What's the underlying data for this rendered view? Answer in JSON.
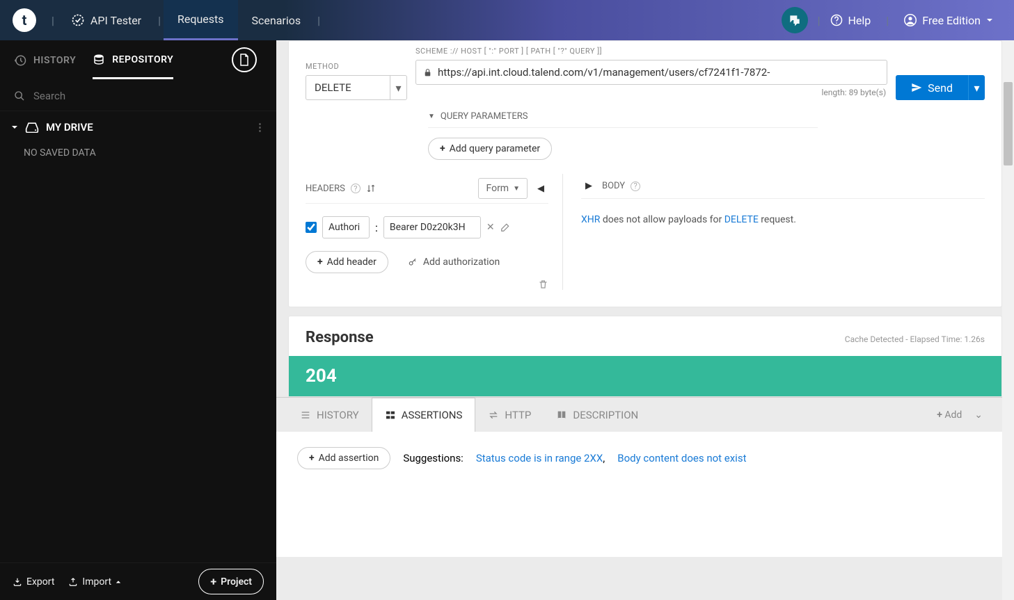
{
  "nav": {
    "brand": "t",
    "api_tester": "API Tester",
    "requests": "Requests",
    "scenarios": "Scenarios",
    "help": "Help",
    "edition": "Free Edition"
  },
  "sidebar": {
    "history": "HISTORY",
    "repository": "REPOSITORY",
    "search_placeholder": "Search",
    "my_drive": "MY DRIVE",
    "no_data": "NO SAVED DATA",
    "export": "Export",
    "import": "Import",
    "project": "Project"
  },
  "request": {
    "method_label": "METHOD",
    "method": "DELETE",
    "url_label": "SCHEME :// HOST [ \":\" PORT ] [ PATH [ \"?\" QUERY ]]",
    "url": "https://api.int.cloud.talend.com/v1/management/users/cf7241f1-7872-",
    "length": "length: 89 byte(s)",
    "send": "Send",
    "qp_title": "QUERY PARAMETERS",
    "qp_add": "Add query parameter",
    "headers_label": "HEADERS",
    "form": "Form",
    "hdr_name": "Authori",
    "hdr_val": "Bearer D0z20k3H",
    "add_header": "Add header",
    "add_auth": "Add authorization",
    "body_label": "BODY",
    "body_xhr": "XHR",
    "body_mid": " does not allow payloads for ",
    "body_delete": "DELETE",
    "body_end": " request."
  },
  "response": {
    "title": "Response",
    "meta": "Cache Detected - Elapsed Time: 1.26s",
    "status": "204"
  },
  "tabs": {
    "history": "HISTORY",
    "assertions": "ASSERTIONS",
    "http": "HTTP",
    "description": "DESCRIPTION",
    "add": "Add"
  },
  "assertions": {
    "add": "Add assertion",
    "suggestions": "Suggestions:",
    "s1": "Status code is in range 2XX",
    "s2": "Body content does not exist"
  }
}
